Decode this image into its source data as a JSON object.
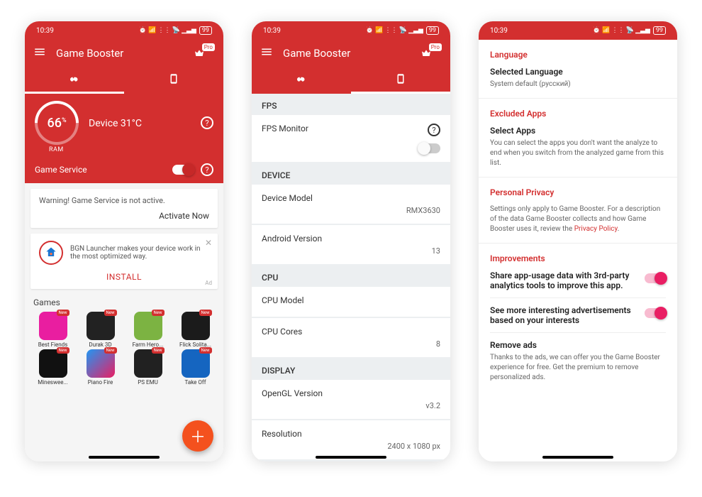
{
  "clock": "10:39",
  "battery": "99",
  "app_title": "Game Booster",
  "pro_badge": "Pro",
  "screen1": {
    "ram_pct": "66",
    "ram_unit": "%",
    "ram_label": "RAM",
    "temp_label": "Device  31°C",
    "game_service": "Game Service",
    "warning": "Warning! Game Service is not active.",
    "activate": "Activate Now",
    "promo_text": "BGN Launcher makes your device work in the most optimized way.",
    "promo_cta": "INSTALL",
    "ad": "Ad",
    "games_header": "Games",
    "games": [
      {
        "name": "Best Fiends",
        "color": "#e91ea0"
      },
      {
        "name": "Durak 3D",
        "color": "#222"
      },
      {
        "name": "Farm Hero...",
        "color": "#7cb342"
      },
      {
        "name": "Flick Solita...",
        "color": "#1b1b1b"
      },
      {
        "name": "Mineswee...",
        "color": "#111"
      },
      {
        "name": "Piano Fire",
        "color": "linear-gradient(135deg,#2196f3,#e91e63)"
      },
      {
        "name": "PS EMU",
        "color": "#212121"
      },
      {
        "name": "Take Off",
        "color": "#1565c0"
      }
    ],
    "new_badge": "New"
  },
  "screen2": {
    "sections": {
      "fps": {
        "header": "FPS",
        "monitor": "FPS Monitor"
      },
      "device": {
        "header": "DEVICE",
        "model_l": "Device Model",
        "model_v": "RMX3630",
        "android_l": "Android Version",
        "android_v": "13"
      },
      "cpu": {
        "header": "CPU",
        "model_l": "CPU Model",
        "model_v": "",
        "cores_l": "CPU Cores",
        "cores_v": "8"
      },
      "display": {
        "header": "DISPLAY",
        "gl_l": "OpenGL Version",
        "gl_v": "v3.2",
        "res_l": "Resolution",
        "res_v": "2400 x 1080 px"
      }
    }
  },
  "screen3": {
    "language": {
      "header": "Language",
      "title": "Selected Language",
      "value": "System default (русский)"
    },
    "excluded": {
      "header": "Excluded Apps",
      "title": "Select Apps",
      "sub": "You can select the apps you don't want the analyze to end when you switch from the analyzed game from this list."
    },
    "privacy": {
      "header": "Personal Privacy",
      "sub_pre": "Settings only apply to Game Booster. For a description of the data Game Booster collects and how Game Booster uses it, review the ",
      "link": "Privacy Policy"
    },
    "improvements": {
      "header": "Improvements",
      "share": "Share app-usage data with 3rd-party analytics tools to improve this app.",
      "ads_interest": "See more interesting advertisements based on your interests",
      "remove_title": "Remove ads",
      "remove_sub": "Thanks to the ads, we can offer you the Game Booster experience for free. Get the premium to remove personalized ads."
    }
  }
}
